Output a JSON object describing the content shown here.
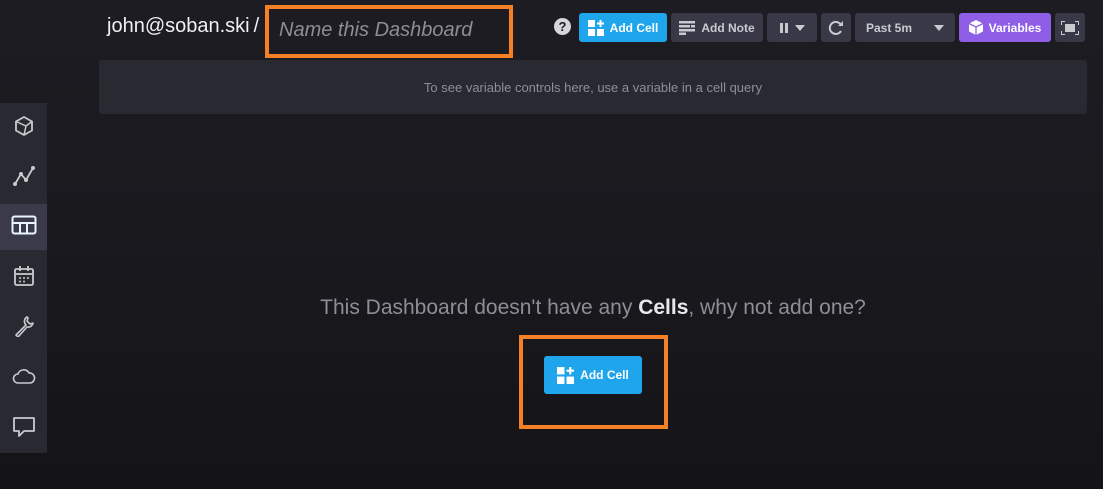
{
  "header": {
    "breadcrumb_user": "john@soban.ski",
    "breadcrumb_sep": "/",
    "dashboard_name_placeholder": "Name this Dashboard"
  },
  "toolbar": {
    "help_label": "?",
    "add_cell_label": "Add Cell",
    "add_note_label": "Add Note",
    "time_range_label": "Past 5m",
    "variables_label": "Variables"
  },
  "variables_bar": {
    "message": "To see variable controls here, use a variable in a cell query"
  },
  "sidebar": {
    "items": [
      {
        "icon": "data-explorer-icon"
      },
      {
        "icon": "graph-icon"
      },
      {
        "icon": "dashboards-icon",
        "active": true
      },
      {
        "icon": "calendar-icon"
      },
      {
        "icon": "wrench-icon"
      },
      {
        "icon": "cloud-icon"
      },
      {
        "icon": "feedback-icon"
      }
    ]
  },
  "empty_state": {
    "text_before": "This Dashboard doesn't have any ",
    "text_bold": "Cells",
    "text_after": ", why not add one?",
    "add_cell_label": "Add Cell"
  },
  "colors": {
    "accent_blue": "#1ea5ec",
    "accent_purple": "#8e5ee6",
    "highlight_orange": "#f58026"
  }
}
